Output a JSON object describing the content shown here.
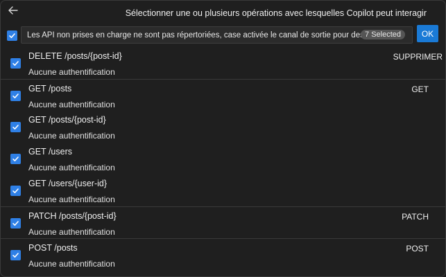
{
  "header": {
    "title": "Sélectionner une ou plusieurs opérations avec lesquelles Copilot peut interagir"
  },
  "quickpick": {
    "filter_text": "Les API non prises en charge ne sont pas répertoriées, case activée le canal de sortie pour des raisons",
    "selected_count": "7 Selected",
    "ok_label": "OK"
  },
  "operations": [
    {
      "title": "DELETE /posts/{post-id}",
      "subtitle": "Aucune authentification",
      "method": "SUPPRIMER"
    },
    {
      "title": "GET /posts",
      "subtitle": "Aucune authentification",
      "method": "GET"
    },
    {
      "title": "GET /posts/{post-id}",
      "subtitle": "Aucune authentification",
      "method": ""
    },
    {
      "title": "GET /users",
      "subtitle": "Aucune authentification",
      "method": ""
    },
    {
      "title": "GET /users/{user-id}",
      "subtitle": "Aucune authentification",
      "method": ""
    },
    {
      "title": "PATCH /posts/{post-id}",
      "subtitle": "Aucune authentification",
      "method": "PATCH"
    },
    {
      "title": "POST /posts",
      "subtitle": "Aucune authentification",
      "method": "POST"
    }
  ],
  "icons": {
    "back": "arrow-left-icon",
    "checkbox": "checkmark-icon"
  },
  "colors": {
    "accent": "#1a7ad6",
    "checkbox": "#2f80e6",
    "background": "#1f1f1f"
  }
}
